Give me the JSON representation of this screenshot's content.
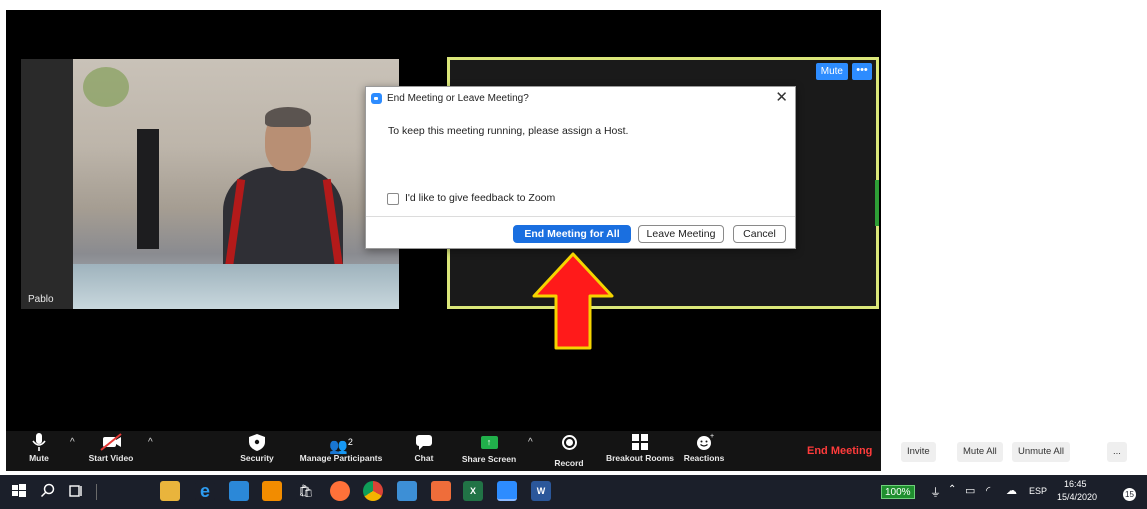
{
  "participant": {
    "name": "Pablo"
  },
  "speaker_tile": {
    "mute_label": "Mute",
    "more_label": "•••"
  },
  "dialog": {
    "title": "End Meeting or Leave Meeting?",
    "close_label": "✕",
    "message": "To keep this meeting running, please assign a Host.",
    "feedback_checkbox_label": "I'd like to give feedback to Zoom",
    "feedback_checked": false,
    "end_for_all_label": "End Meeting for All",
    "leave_label": "Leave Meeting",
    "cancel_label": "Cancel"
  },
  "toolbar": {
    "mute_label": "Mute",
    "start_video_label": "Start Video",
    "security_label": "Security",
    "manage_participants_label": "Manage Participants",
    "participant_count": "2",
    "chat_label": "Chat",
    "share_screen_label": "Share Screen",
    "record_label": "Record",
    "breakout_rooms_label": "Breakout Rooms",
    "reactions_label": "Reactions",
    "end_meeting_label": "End Meeting",
    "caret": "^",
    "share_arrow": "↑"
  },
  "participants_panel": {
    "invite_label": "Invite",
    "mute_all_label": "Mute All",
    "unmute_all_label": "Unmute All",
    "more_label": "..."
  },
  "taskbar": {
    "battery": "100%",
    "language": "ESP",
    "time": "16:45",
    "date": "15/4/2020",
    "notifications": "15"
  },
  "colors": {
    "zoom_blue": "#2d8cff",
    "end_red": "#ff3b3b",
    "active_speaker_border": "#dbe77a",
    "arrow_red": "#ff1a1a",
    "arrow_outline": "#f5d400"
  }
}
